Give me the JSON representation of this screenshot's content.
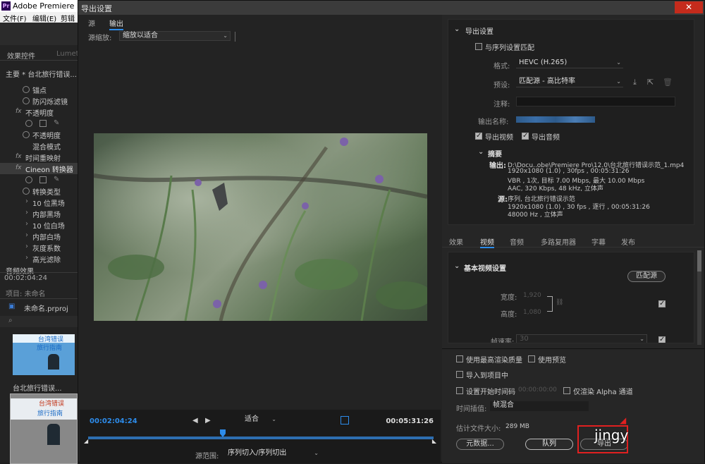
{
  "app": {
    "title": "Adobe Premiere Pro",
    "menu": [
      "文件(F)",
      "编辑(E)",
      "剪辑"
    ]
  },
  "left_panel": {
    "tabs": [
      "效果控件",
      "Lumetri"
    ],
    "sequence_label": "主要 * 台北旅行错误...",
    "rows": [
      {
        "label": "锚点"
      },
      {
        "label": "防闪烁滤镜"
      },
      {
        "label": "不透明度",
        "fx": "fx"
      },
      {
        "label": "不透明度"
      },
      {
        "label": "混合模式"
      },
      {
        "label": "时间重映射",
        "fx": "fx"
      },
      {
        "label": "Cineon 转换器",
        "fx": "fx"
      },
      {
        "label": "转换类型"
      },
      {
        "label": "10 位黑场"
      },
      {
        "label": "内部黑场"
      },
      {
        "label": "10 位白场"
      },
      {
        "label": "内部白场"
      },
      {
        "label": "灰度系数"
      },
      {
        "label": "高光滤除"
      },
      {
        "label": "音频效果"
      }
    ],
    "timecode": "00:02:04:24",
    "project_tab": "项目: 未命名",
    "project_file": "未命名.prproj",
    "thumb_label": "台北旅行错误...",
    "thumb_text_1": "台湾错误",
    "thumb_text_2": "旅行指南"
  },
  "dialog": {
    "title": "导出设置",
    "close_icon": "close-icon",
    "tabs": [
      "源",
      "输出"
    ],
    "source_scaling_label": "源缩放:",
    "source_scaling_value": "缩放以适合",
    "timeline": {
      "current_time": "00:02:04:24",
      "end_time": "00:05:31:26",
      "fit_value": "适合",
      "playhead_fraction": 0.39,
      "source_range_label": "源范围:",
      "source_range_value": "序列切入/序列切出"
    },
    "export_settings": {
      "header": "导出设置",
      "match_sequence": "与序列设置匹配",
      "format_label": "格式:",
      "format_value": "HEVC (H.265)",
      "preset_label": "预设:",
      "preset_value": "匹配源 - 高比特率",
      "comment_label": "注释:",
      "output_name_label": "输出名称:",
      "export_video": "导出视频",
      "export_audio": "导出音频",
      "summary_header": "摘要",
      "output_label": "输出:",
      "output_lines": [
        "D:\\Docu..obe\\Premiere Pro\\12.0\\台北旅行错误示范_1.mp4",
        "1920x1080 (1.0) , 30fps , 00:05:31:26",
        "VBR , 1次, 目标 7.00 Mbps, 最大 10.00 Mbps",
        "AAC, 320 Kbps, 48 kHz, 立体声"
      ],
      "source_label": "源:",
      "source_lines": [
        "序列, 台北旅行错误示范",
        "1920x1080 (1.0) , 30 fps , 逐行 , 00:05:31:26",
        "48000 Hz , 立体声"
      ]
    },
    "sub_tabs": [
      "效果",
      "视频",
      "音频",
      "多路复用器",
      "字幕",
      "发布"
    ],
    "active_sub_tab": "视频",
    "video_settings": {
      "header": "基本视频设置",
      "match_source": "匹配源",
      "width_label": "宽度:",
      "width_value": "1,920",
      "height_label": "高度:",
      "height_value": "1,080",
      "frame_rate_label": "帧速率:",
      "frame_rate_value": "30"
    },
    "bottom": {
      "max_render_quality": "使用最高渲染质量",
      "use_previews": "使用预览",
      "import_into_project": "导入到项目中",
      "set_start_timecode": "设置开始时间码",
      "start_timecode_value": "00:00:00:00",
      "render_alpha": "仅渲染 Alpha 通道",
      "time_interpolation_label": "时间插值:",
      "time_interpolation_value": "帧混合",
      "file_size_label": "估计文件大小:",
      "file_size_value": "289 MB",
      "metadata_button": "元数据...",
      "queue_button": "队列",
      "export_button": "导出",
      "watermark_text": "jingy"
    }
  }
}
